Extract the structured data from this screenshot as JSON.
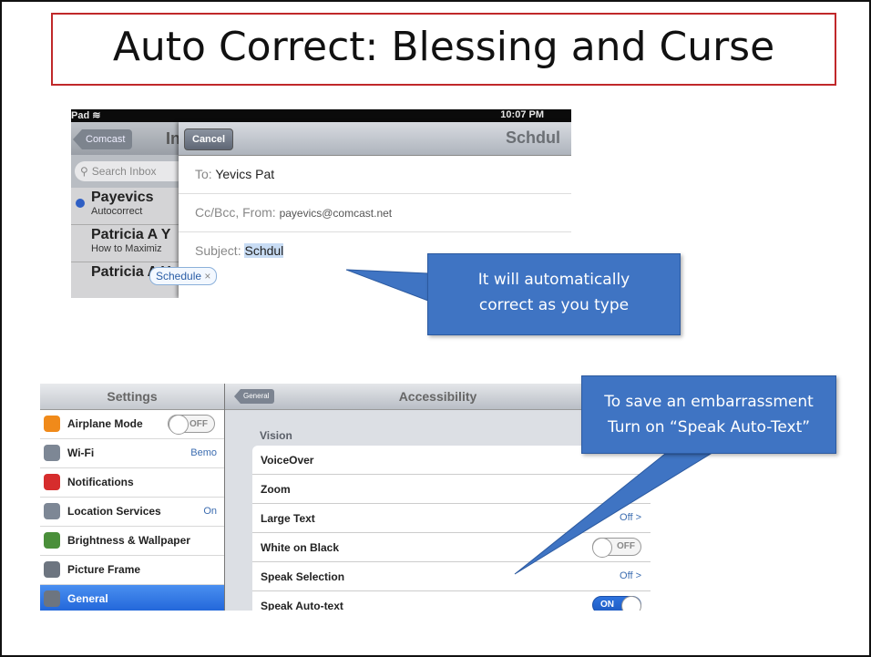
{
  "slide": {
    "title": "Auto Correct: Blessing and Curse"
  },
  "mail": {
    "status_left": "Pad",
    "status_time": "10:07 PM",
    "inbox": {
      "back_label": "Comcast",
      "title_partial": "In",
      "search_placeholder": "Search Inbox",
      "messages": [
        {
          "from": "Payevics",
          "subject": "Autocorrect",
          "unread": true
        },
        {
          "from": "Patricia A Y",
          "subject": "How to Maximiz",
          "unread": false
        },
        {
          "from": "Patricia A Y",
          "subject": "",
          "unread": false
        }
      ]
    },
    "compose": {
      "cancel_label": "Cancel",
      "title": "Schdul",
      "to_label": "To:",
      "to_value": "Yevics Pat",
      "ccbcc_label": "Cc/Bcc, From:",
      "from_value": "payevics@comcast.net",
      "subject_label": "Subject:",
      "subject_value": "Schdul",
      "suggestion": "Schedule",
      "suggestion_close": "×"
    }
  },
  "callouts": {
    "autocorrect_line1": "It will automatically",
    "autocorrect_line2": "correct as you type",
    "embarrass_line1": "To save an embarrassment",
    "embarrass_line2": "Turn on “Speak Auto-Text”",
    "color": "#3f74c3"
  },
  "settings": {
    "title": "Settings",
    "items": [
      {
        "label": "Airplane Mode",
        "value": "OFF",
        "icon": "airplane-icon",
        "color": "#f08a1a"
      },
      {
        "label": "Wi-Fi",
        "value": "Bemo",
        "icon": "wifi-icon",
        "color": "#7d8795"
      },
      {
        "label": "Notifications",
        "value": "",
        "icon": "notifications-icon",
        "color": "#d62d2d"
      },
      {
        "label": "Location Services",
        "value": "On",
        "icon": "location-icon",
        "color": "#7d8795"
      },
      {
        "label": "Brightness & Wallpaper",
        "value": "",
        "icon": "brightness-icon",
        "color": "#4a8f3a"
      },
      {
        "label": "Picture Frame",
        "value": "",
        "icon": "picture-frame-icon",
        "color": "#6d7580"
      },
      {
        "label": "General",
        "value": "",
        "icon": "gear-icon",
        "color": "#6d7580"
      }
    ]
  },
  "accessibility": {
    "back_label": "General",
    "title": "Accessibility",
    "section": "Vision",
    "rows": [
      {
        "label": "VoiceOver",
        "value": ""
      },
      {
        "label": "Zoom",
        "value": ""
      },
      {
        "label": "Large Text",
        "value": "Off >"
      },
      {
        "label": "White on Black",
        "value": "OFF"
      },
      {
        "label": "Speak Selection",
        "value": "Off >"
      },
      {
        "label": "Speak Auto-text",
        "value": "ON"
      }
    ]
  }
}
